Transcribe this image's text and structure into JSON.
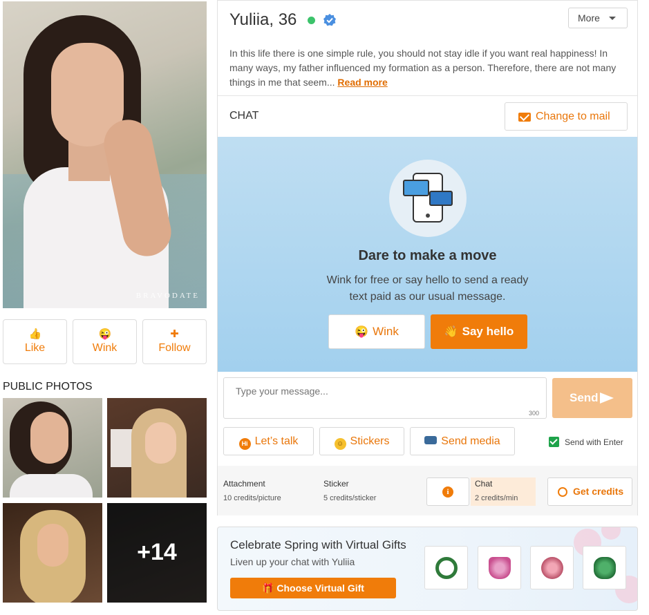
{
  "profile": {
    "name_age": "Yuliia, 36",
    "watermark": "BRAVODATE",
    "more_label": "More",
    "bio": "In this life there is one simple rule, you should not stay idle if you want real happiness! In many ways, my father influenced my formation as a person. Therefore, there are not many things in me that seem...",
    "read_more": "Read more"
  },
  "actions": [
    {
      "label": "Like",
      "icon": "thumbs-up-icon"
    },
    {
      "label": "Wink",
      "icon": "wink-emoji-icon"
    },
    {
      "label": "Follow",
      "icon": "add-user-icon"
    }
  ],
  "public_photos": {
    "title": "PUBLIC PHOTOS",
    "more_count": "+14"
  },
  "chat": {
    "label": "CHAT",
    "change_to_mail": "Change to mail",
    "hero_title": "Dare to make a move",
    "hero_text": "Wink for free or say hello to send a ready text paid as our usual message.",
    "wink_label": "Wink",
    "say_hello_label": "Say hello",
    "input_placeholder": "Type your message...",
    "char_limit": "300",
    "send_label": "Send",
    "lets_talk": "Let’s talk",
    "stickers": "Stickers",
    "send_media": "Send media",
    "send_with_enter": "Send with Enter",
    "send_with_enter_checked": true
  },
  "pricing": {
    "attachment_label": "Attachment",
    "attachment_value": "10 credits/picture",
    "sticker_label": "Sticker",
    "sticker_value": "5 credits/sticker",
    "chat_label": "Chat",
    "chat_value": "2 credits/min",
    "get_credits": "Get credits"
  },
  "gifts": {
    "title": "Celebrate Spring with Virtual Gifts",
    "subtitle": "Liven up your chat with Yuliia",
    "button": "Choose Virtual Gift",
    "items": [
      "wreath-gift-icon",
      "crown-gift-icon",
      "flower-tree-gift-icon",
      "clover-gift-icon"
    ]
  },
  "colors": {
    "accent": "#f07c0a",
    "online": "#3cc36b",
    "verified": "#4a8fe0",
    "hero_bg": "#aed6f0"
  }
}
